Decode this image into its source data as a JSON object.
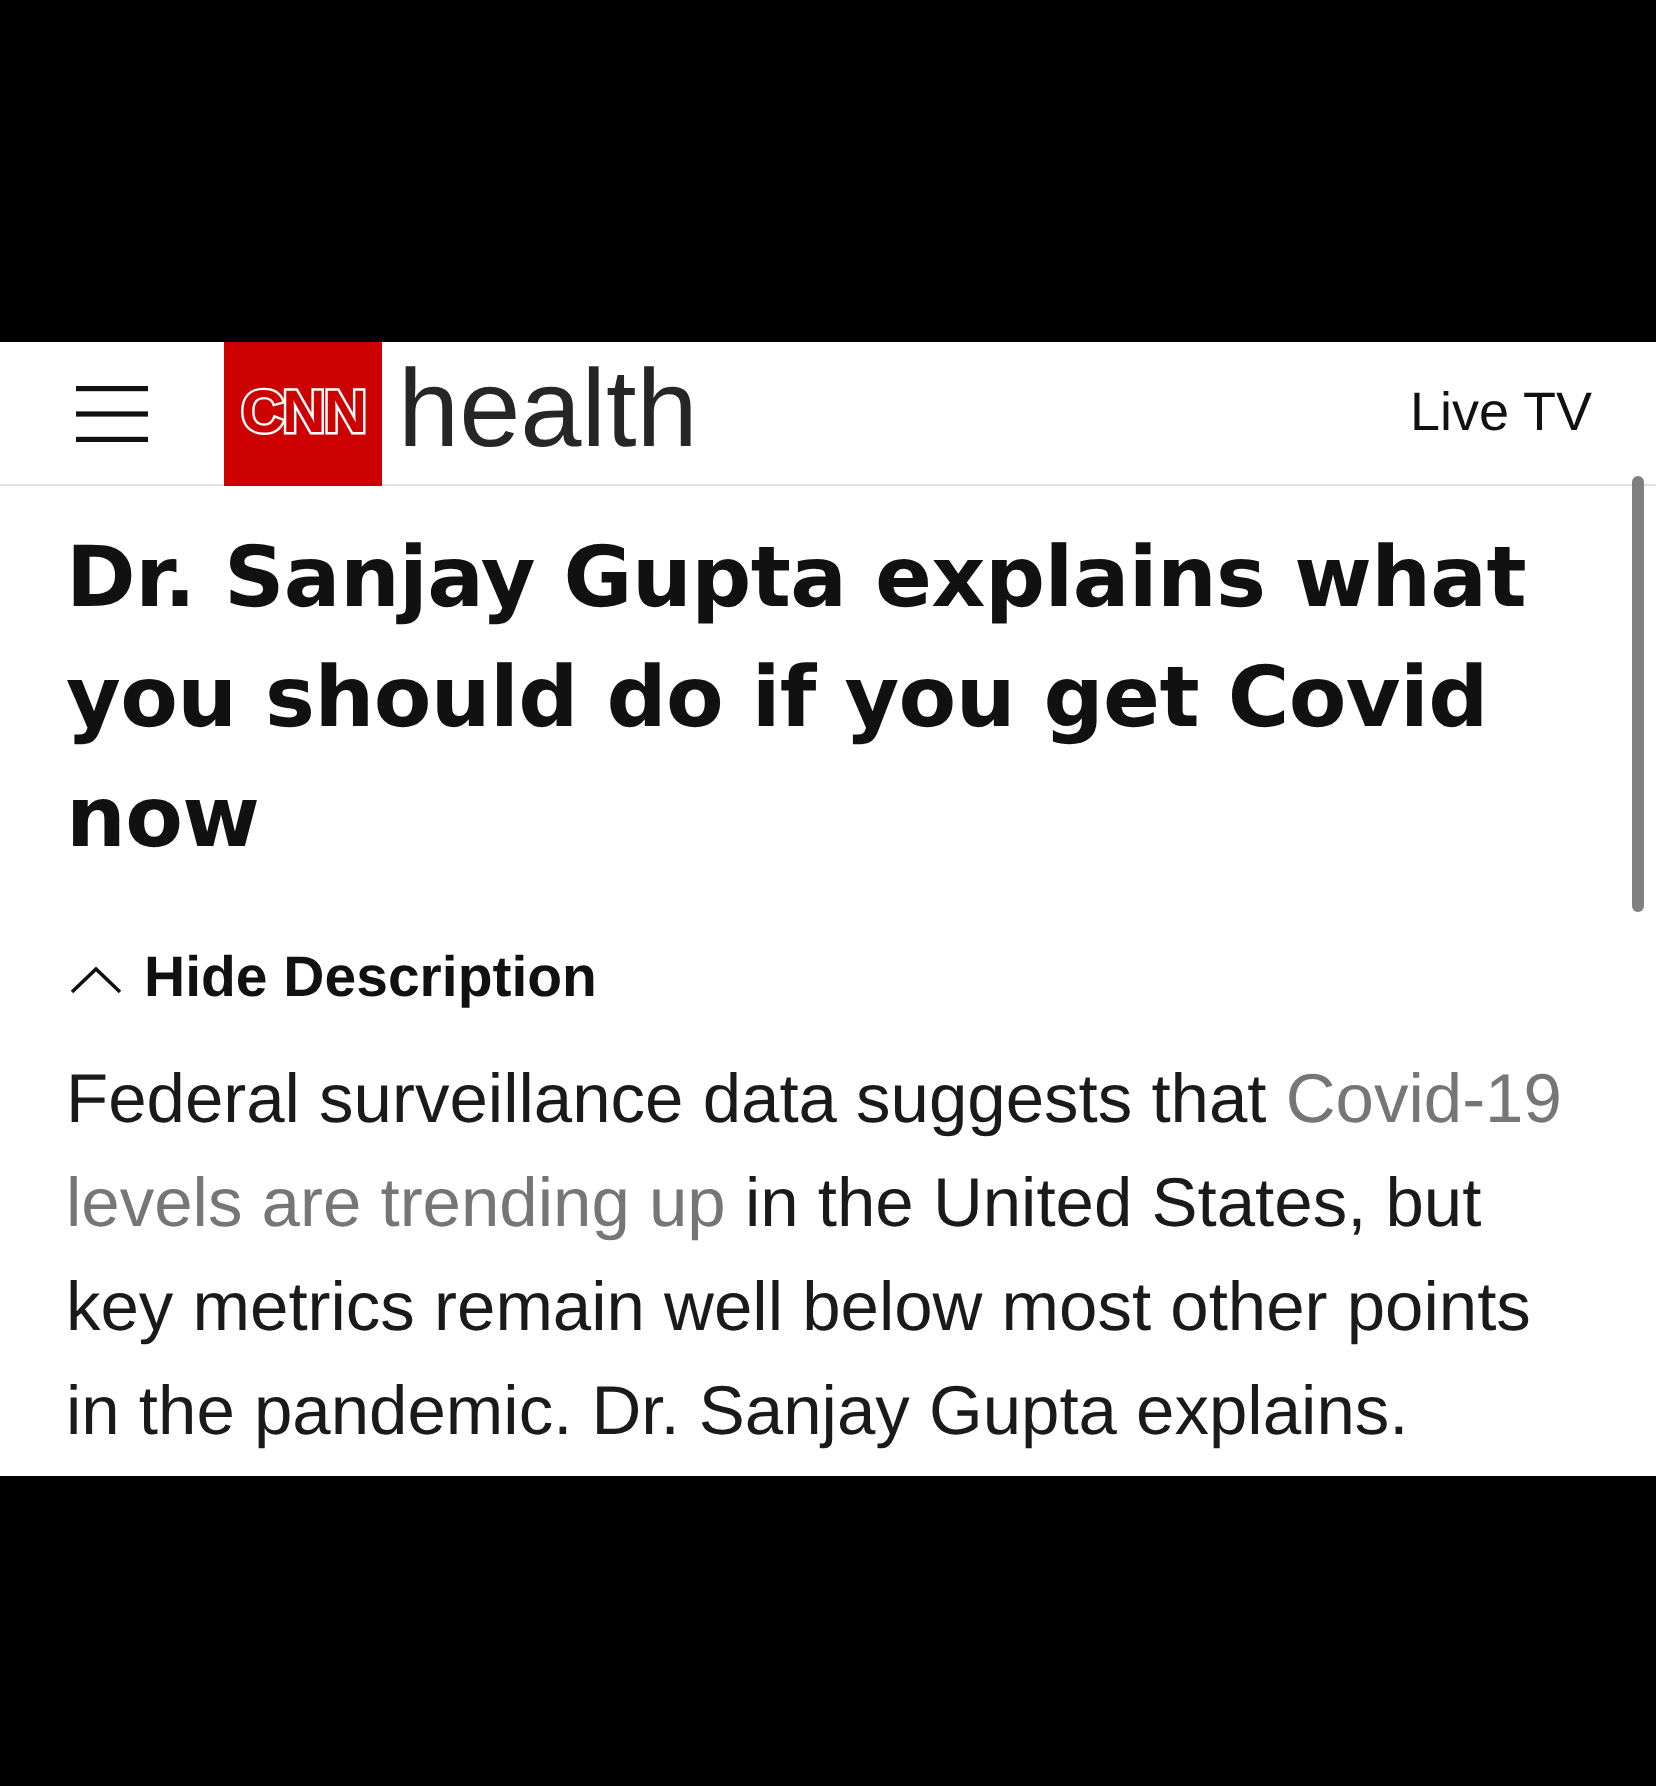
{
  "header": {
    "logo": {
      "brand": "CNN",
      "section": "health"
    },
    "live_link": "Live TV"
  },
  "article": {
    "headline": "Dr. Sanjay Gupta explains what you should do if you get Covid now",
    "description_toggle": {
      "label": "Hide Description",
      "expanded": true
    },
    "description": [
      {
        "kind": "text",
        "text": "Federal surveillance data suggests that"
      },
      {
        "kind": "link",
        "lines": [
          "Covid-19",
          "levels are trending up"
        ]
      },
      {
        "kind": "text",
        "text": "in the United States, but key metrics remain well below most other points in the pandemic. Dr. Sanjay Gupta explains."
      }
    ]
  }
}
